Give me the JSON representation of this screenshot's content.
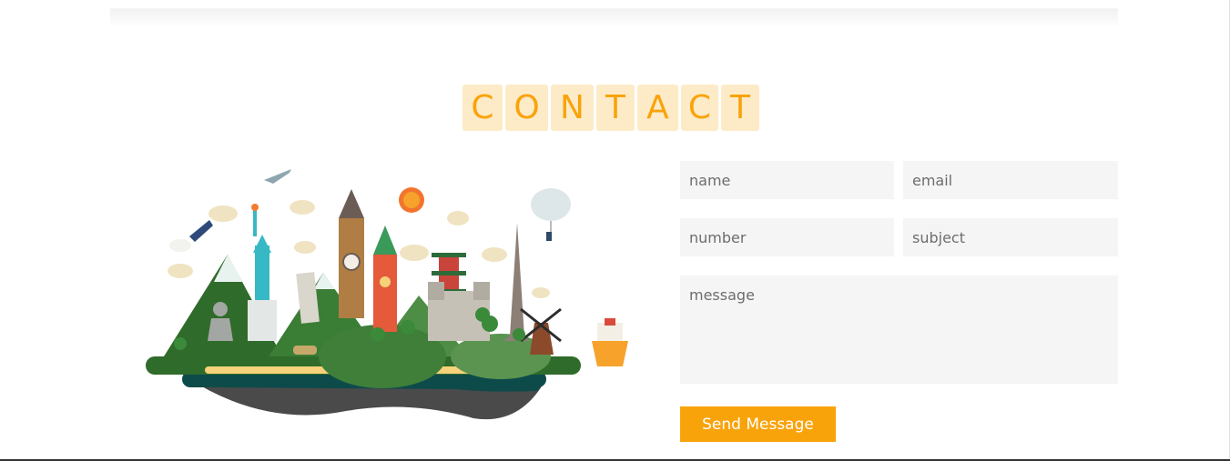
{
  "heading": {
    "letters": [
      "C",
      "O",
      "N",
      "T",
      "A",
      "C",
      "T"
    ]
  },
  "form": {
    "name_placeholder": "name",
    "email_placeholder": "email",
    "number_placeholder": "number",
    "subject_placeholder": "subject",
    "message_placeholder": "message",
    "submit_label": "Send Message"
  },
  "illustration": {
    "name": "travel-landmarks-island"
  },
  "colors": {
    "accent": "#f9a30b",
    "heading_tile": "#fdebc8",
    "field_background": "#f5f5f5",
    "page_background": "#ffffff"
  }
}
